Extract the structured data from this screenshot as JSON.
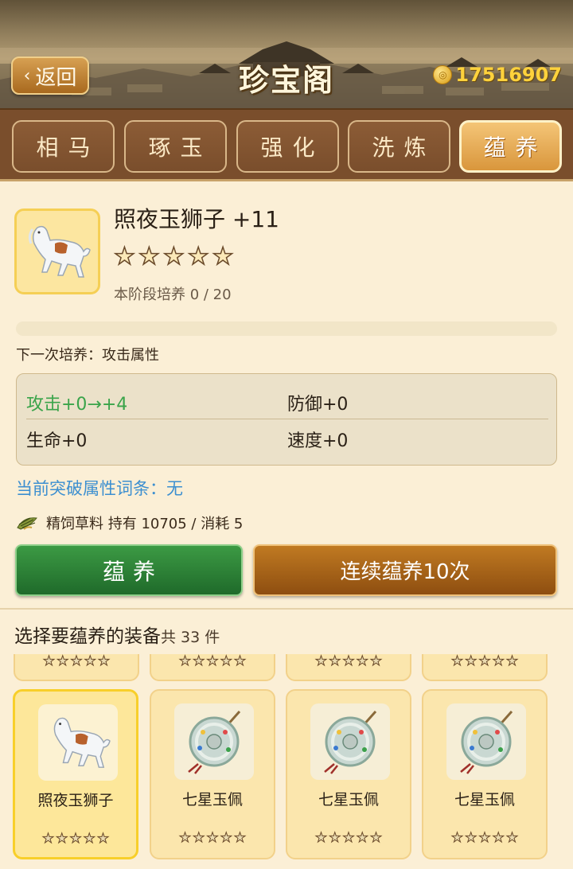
{
  "header": {
    "back_label": "返回",
    "title": "珍宝阁",
    "coins": "17516907"
  },
  "tabs": [
    {
      "label": "相马",
      "active": false
    },
    {
      "label": "琢玉",
      "active": false
    },
    {
      "label": "强化",
      "active": false
    },
    {
      "label": "洗炼",
      "active": false
    },
    {
      "label": "蕴养",
      "active": true
    }
  ],
  "item": {
    "name": "照夜玉狮子 +11",
    "stars": 5,
    "stage_text": "本阶段培养 0 / 20",
    "progress": 0.0,
    "next_training": "下一次培养：攻击属性"
  },
  "stats": {
    "attack": "攻击+0→+4",
    "defense": "防御+0",
    "hp": "生命+0",
    "speed": "速度+0"
  },
  "breakthrough": "当前突破属性词条：无",
  "material": {
    "icon": "grass-bundle-icon",
    "text": "精饲草料  持有 10705 / 消耗 5"
  },
  "buttons": {
    "nourish": "蕴养",
    "nourish10": "连续蕴养10次"
  },
  "select": {
    "title": "选择要蕴养的装备",
    "count": "共 33 件"
  },
  "equipment": [
    {
      "name": "照夜玉狮子",
      "stars": 5,
      "selected": true,
      "icon": "white-horse-icon"
    },
    {
      "name": "七星玉佩",
      "stars": 5,
      "selected": false,
      "icon": "jade-pendant-icon"
    },
    {
      "name": "七星玉佩",
      "stars": 5,
      "selected": false,
      "icon": "jade-pendant-icon"
    },
    {
      "name": "七星玉佩",
      "stars": 5,
      "selected": false,
      "icon": "jade-pendant-icon"
    }
  ],
  "colors": {
    "attack_highlight": "#3aa44a",
    "breakthrough_text": "#3c8fd0",
    "nourish_button": "#2e8a3a",
    "nourish10_button": "#a8661a",
    "tab_active": "#e6ab55"
  }
}
